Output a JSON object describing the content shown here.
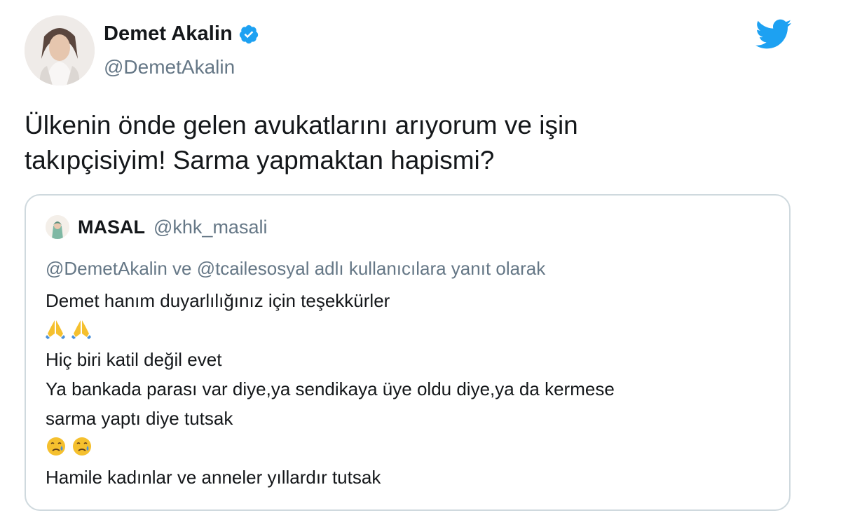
{
  "author": {
    "display_name": "Demet Akalin",
    "handle": "@DemetAkalin",
    "verified": true
  },
  "tweet": {
    "text_lines": [
      "Ülkenin önde gelen avukatlarını arıyorum ve işin",
      "takıpçisiyim! Sarma yapmaktan hapismi?"
    ]
  },
  "quoted_tweet": {
    "display_name": "MASAL",
    "handle": "@khk_masali",
    "reply_context": "@DemetAkalin ve @tcailesosyal adlı kullanıcılara yanıt olarak",
    "lines": [
      "Demet hanım duyarlılığınız için teşekkürler",
      "Hiç biri katil değil evet",
      "Ya bankada parası var diye,ya sendikaya üye oldu diye,ya da kermese",
      "sarma yaptı diye tutsak",
      "Hamile kadınlar ve anneler yıllardır tutsak"
    ],
    "emoji_rows": [
      "folded-hands-emoji x2",
      "sad-relieved-face-emoji x2"
    ]
  },
  "colors": {
    "brand_blue": "#1da1f2",
    "text_primary": "#14171a",
    "text_secondary": "#657786",
    "card_border": "#cfd9de",
    "emoji_yellow": "#f5c02e"
  },
  "icons": [
    "verified-badge-icon",
    "twitter-bird-icon"
  ]
}
